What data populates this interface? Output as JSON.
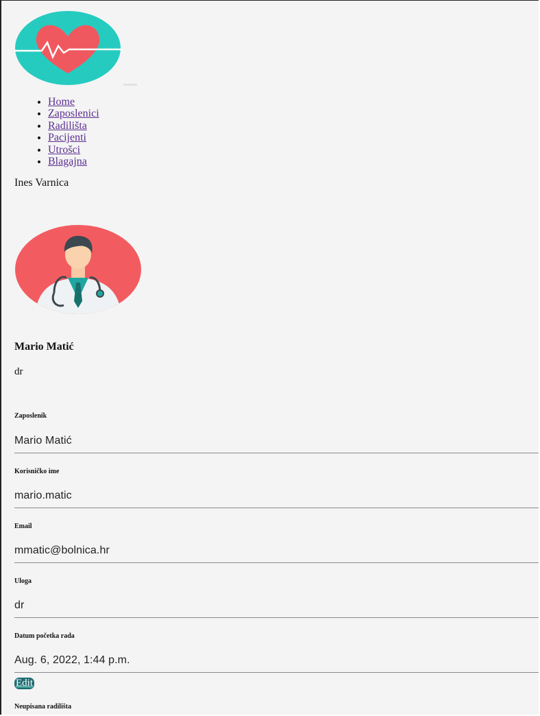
{
  "nav": {
    "items": [
      "Home",
      "Zaposlenici",
      "Radilišta",
      "Pacijenti",
      "Utrošci",
      "Blagajna"
    ]
  },
  "current_user": "Ines Varnica",
  "profile": {
    "name": "Mario Matić",
    "role": "dr"
  },
  "fields": [
    {
      "label": "Zaposlenik",
      "value": "Mario Matić"
    },
    {
      "label": "Korisničko ime",
      "value": "mario.matic"
    },
    {
      "label": "Email",
      "value": "mmatic@bolnica.hr"
    },
    {
      "label": "Uloga",
      "value": "dr"
    },
    {
      "label": "Datum početka rada",
      "value": "Aug. 6, 2022, 1:44 p.m."
    }
  ],
  "edit_label": "Edit",
  "unassigned_sites_label": "Neupisana radilišta",
  "colors": {
    "teal": "#26cbc0",
    "heart": "#f0585f",
    "avatar_bg": "#f25c61",
    "link": "#5b2e91"
  }
}
